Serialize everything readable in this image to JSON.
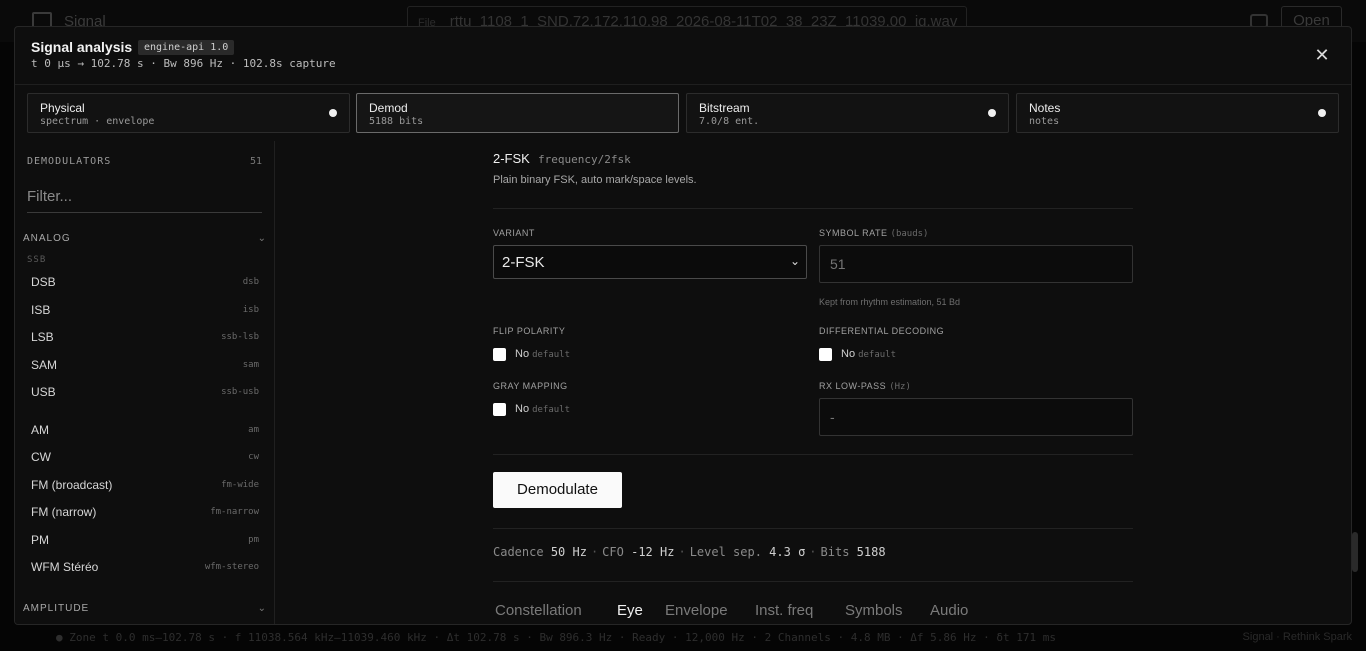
{
  "background": {
    "brand": "Signal",
    "file_label": "File",
    "file_name": "rttu_1108_1_SND.72.172.110.98_2026-08-11T02_38_23Z_11039.00_iq.wav",
    "open_label": "Open",
    "status_text": "● Zone  t 0.0 ms–102.78 s  ·  f 11038.564 kHz–11039.460 kHz  ·  Δt 102.78 s  ·  Bw 896.3 Hz  ·  Ready  ·  12,000 Hz  ·  2 Channels  ·  4.8 MB  ·  Δf 5.86 Hz  ·  δt 171 ms",
    "status_right": "Signal · Rethink Spark"
  },
  "modal": {
    "title": "Signal analysis",
    "badge": "engine-api 1.0",
    "subtitle": "t 0 µs → 102.78 s · Bw 896 Hz · 102.8s capture",
    "close_icon": "close-icon"
  },
  "tabs": [
    {
      "label": "Physical",
      "sub": "spectrum · envelope",
      "dot": true
    },
    {
      "label": "Demod",
      "sub": "5188 bits",
      "dot": false,
      "active": true
    },
    {
      "label": "Bitstream",
      "sub": "7.0/8 ent.",
      "dot": true
    },
    {
      "label": "Notes",
      "sub": "notes",
      "dot": true
    }
  ],
  "sidebar": {
    "heading": "DEMODULATORS",
    "count": "51",
    "filter_placeholder": "Filter...",
    "group_analog": "ANALOG",
    "subgroup_ssb": "SSB",
    "ssb_items": [
      {
        "name": "DSB",
        "code": "dsb"
      },
      {
        "name": "ISB",
        "code": "isb"
      },
      {
        "name": "LSB",
        "code": "ssb-lsb"
      },
      {
        "name": "SAM",
        "code": "sam"
      },
      {
        "name": "USB",
        "code": "ssb-usb"
      }
    ],
    "analog_items": [
      {
        "name": "AM",
        "code": "am"
      },
      {
        "name": "CW",
        "code": "cw"
      },
      {
        "name": "FM (broadcast)",
        "code": "fm-wide"
      },
      {
        "name": "FM (narrow)",
        "code": "fm-narrow"
      },
      {
        "name": "PM",
        "code": "pm"
      },
      {
        "name": "WFM Stéréo",
        "code": "wfm-stereo"
      }
    ],
    "group_amplitude": "AMPLITUDE"
  },
  "main": {
    "algo_name": "2-FSK",
    "algo_id": "frequency/2fsk",
    "algo_desc": "Plain binary FSK, auto mark/space levels.",
    "variant_label": "VARIANT",
    "variant_value": "2-FSK",
    "symbol_rate_label": "SYMBOL RATE",
    "symbol_rate_unit": "(bauds)",
    "symbol_rate_value": "51",
    "symbol_rate_hint": "Kept from rhythm estimation, 51 Bd",
    "flip_label": "FLIP POLARITY",
    "flip_value": "No",
    "diff_label": "DIFFERENTIAL DECODING",
    "diff_value": "No",
    "gray_label": "GRAY MAPPING",
    "gray_value": "No",
    "default_text": "default",
    "lowpass_label": "RX LOW-PASS",
    "lowpass_unit": "(Hz)",
    "lowpass_placeholder": "-",
    "demodulate_label": "Demodulate",
    "stats": {
      "cadence_label": "Cadence",
      "cadence_value": "50 Hz",
      "cfo_label": "CFO",
      "cfo_value": "-12 Hz",
      "levelsep_label": "Level sep.",
      "levelsep_value": "4.3 σ",
      "bits_label": "Bits",
      "bits_value": "5188"
    },
    "view_tabs": [
      "Constellation",
      "Eye",
      "Envelope",
      "Inst. freq",
      "Symbols",
      "Audio"
    ],
    "active_view": "Eye"
  }
}
